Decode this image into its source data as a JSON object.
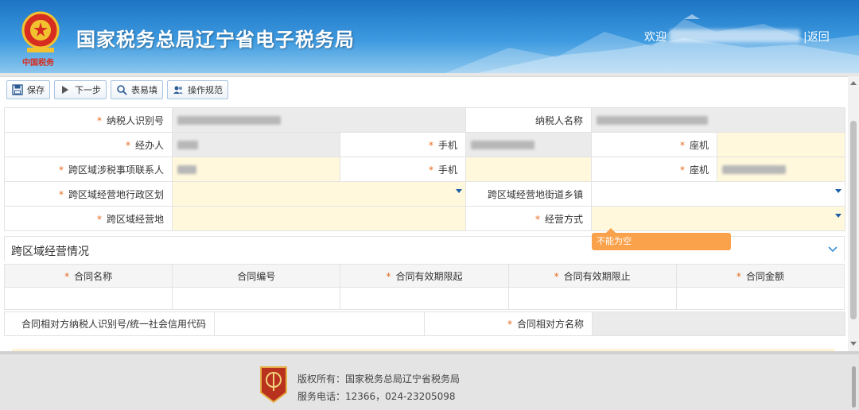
{
  "header": {
    "site_title": "国家税务总局辽宁省电子税务局",
    "emblem_text": "中国税务",
    "welcome": "欢迎",
    "back": "|返回"
  },
  "toolbar": {
    "save": "保存",
    "next": "下一步",
    "quick_fill": "表易填",
    "guide": "操作规范"
  },
  "form": {
    "taxpayer_id_label": "纳税人识别号",
    "taxpayer_name_label": "纳税人名称",
    "handler_label": "经办人",
    "mobile_label": "手机",
    "landline_label": "座机",
    "cross_contact_label": "跨区域涉税事项联系人",
    "mobile2_label": "手机",
    "landline2_label": "座机",
    "region_label": "跨区域经营地行政区划",
    "street_label": "跨区域经营地街道乡镇",
    "location_label": "跨区域经营地",
    "mode_label": "经营方式",
    "required_mark": "*",
    "validation_msg": "不能为空"
  },
  "section": {
    "title": "跨区域经营情况"
  },
  "contract_table": {
    "headers": [
      {
        "label": "合同名称",
        "required": true
      },
      {
        "label": "合同编号",
        "required": false
      },
      {
        "label": "合同有效期限起",
        "required": true
      },
      {
        "label": "合同有效期限止",
        "required": true
      },
      {
        "label": "合同金额",
        "required": true
      }
    ]
  },
  "counterparty": {
    "id_label": "合同相对方纳税人识别号/统一社会信用代码",
    "name_label": "合同相对方名称"
  },
  "footer": {
    "copyright": "版权所有：国家税务总局辽宁省税务局",
    "service": "服务电话：12366，024-23205098",
    "badge_text": "税务"
  },
  "colors": {
    "header_blue": "#1d74c4",
    "required_orange": "#e86a1e",
    "input_yellow": "#fff8dc",
    "tooltip_orange": "#f9a24b"
  }
}
